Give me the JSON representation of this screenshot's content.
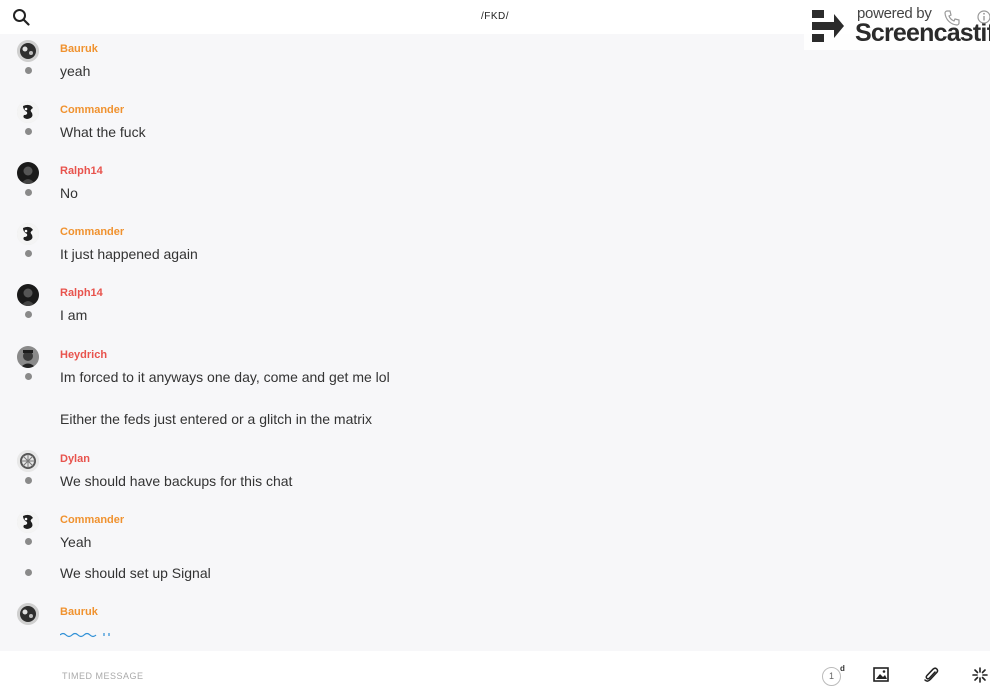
{
  "header": {
    "title": "/FKD/",
    "icons": {
      "search": "search-icon",
      "call": "phone-icon",
      "info": "info-icon"
    }
  },
  "watermark": {
    "powered": "powered by",
    "brand": "Screencastify"
  },
  "colors": {
    "orange": "#f0922f",
    "red": "#e8534d",
    "dot": "#8a8a8a",
    "typing": "#2d8fd6"
  },
  "messages": [
    {
      "sender": "Bauruk",
      "color": "orange",
      "text": "yeah"
    },
    {
      "sender": "Commander",
      "color": "orange",
      "text": "What the fuck"
    },
    {
      "sender": "Ralph14",
      "color": "red",
      "text": "No"
    },
    {
      "sender": "Commander",
      "color": "orange",
      "text": "It just happened again"
    },
    {
      "sender": "Ralph14",
      "color": "red",
      "text": "I am"
    },
    {
      "sender": "Heydrich",
      "color": "red",
      "text": "Im forced to it anyways one day, come and get me lol",
      "extra": "Either the feds just entered or a glitch in the matrix"
    },
    {
      "sender": "Dylan",
      "color": "red",
      "text": "We should have backups for this chat"
    },
    {
      "sender": "Commander",
      "color": "orange",
      "text": "Yeah",
      "extra": "We should set up Signal"
    },
    {
      "sender": "Bauruk",
      "color": "orange",
      "text": ""
    }
  ],
  "composer": {
    "placeholder": "TIMED MESSAGE",
    "timer_value": "1",
    "timer_unit": "d",
    "icons": {
      "image": "image-icon",
      "attach": "paperclip-icon",
      "effects": "sparkle-icon"
    }
  }
}
